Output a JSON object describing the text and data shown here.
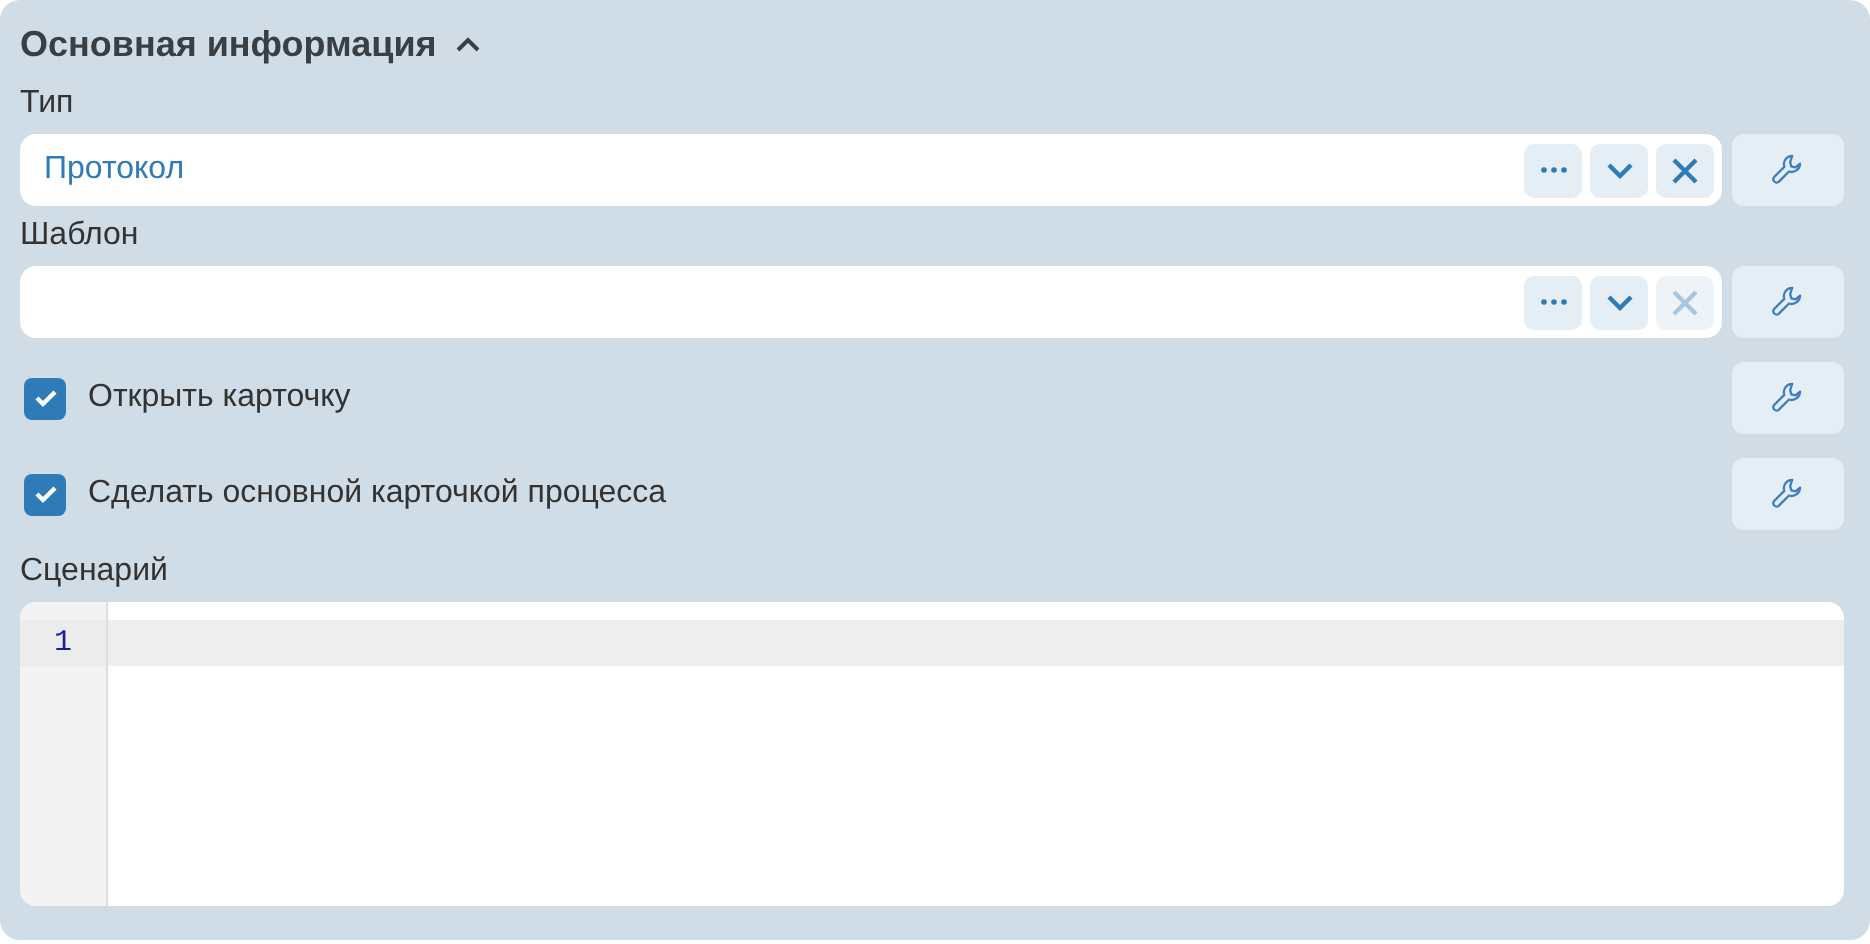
{
  "section": {
    "title": "Основная информация",
    "expanded": true
  },
  "rows": [
    {
      "kind": "lookup",
      "label": "Тип",
      "value": "Протокол",
      "clear_disabled": false
    },
    {
      "kind": "lookup",
      "label": "Шаблон",
      "value": "",
      "clear_disabled": true
    },
    {
      "kind": "checkbox",
      "label": "Открыть карточку",
      "checked": true
    },
    {
      "kind": "checkbox",
      "label": "Сделать основной карточкой процесса",
      "checked": true
    }
  ],
  "script": {
    "label": "Сценарий",
    "line_numbers": [
      "1"
    ]
  }
}
